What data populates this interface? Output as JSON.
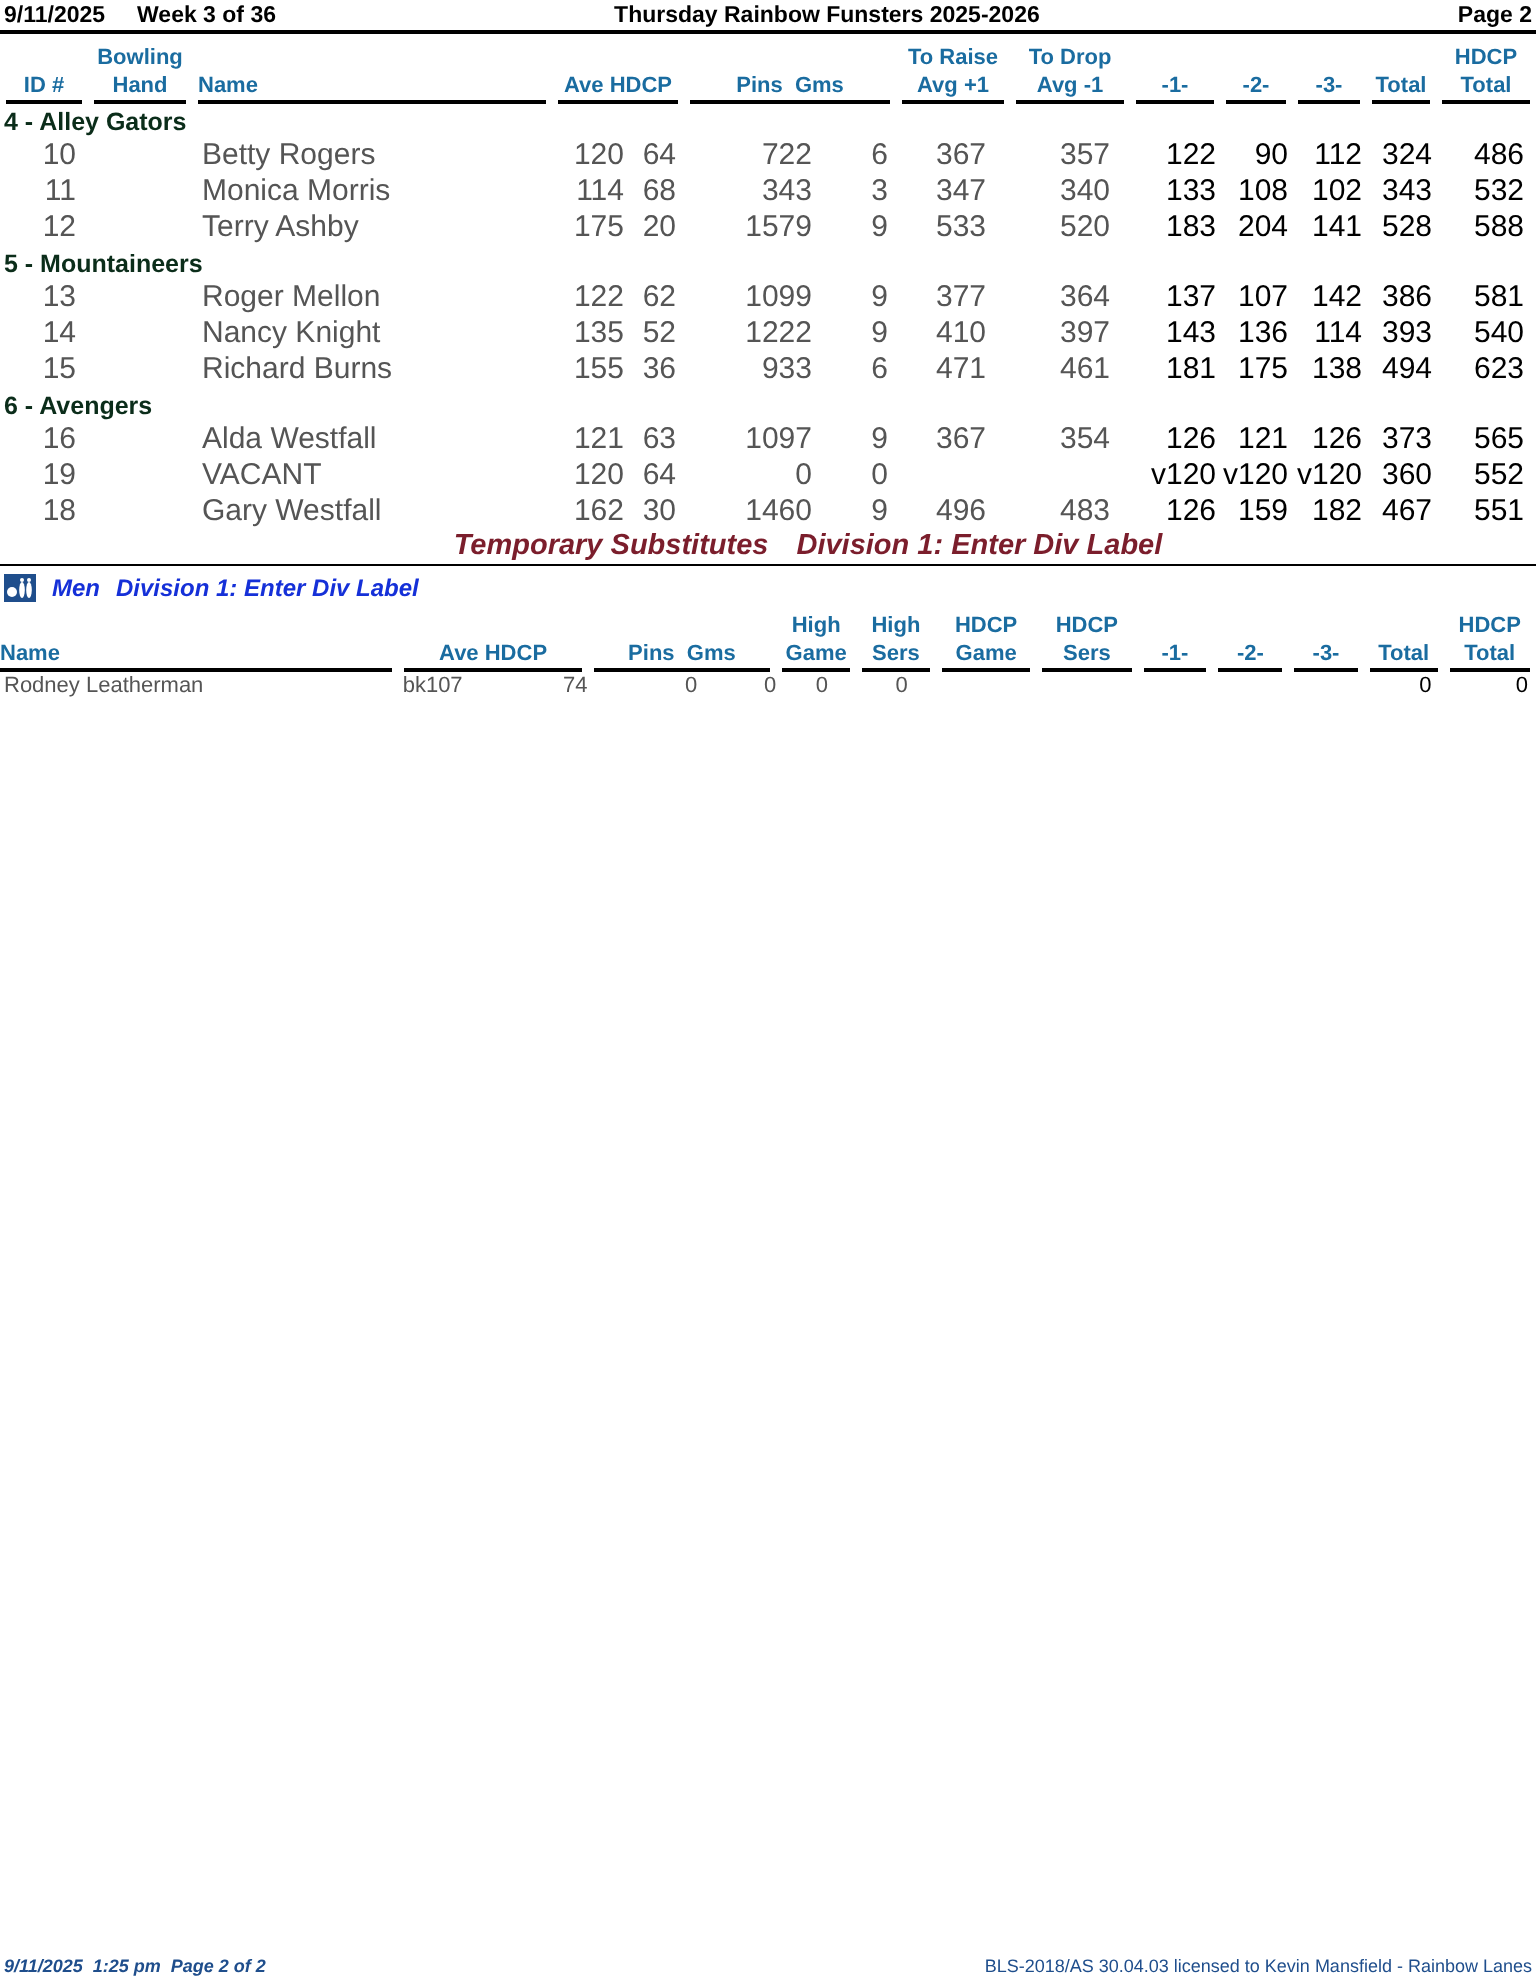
{
  "header": {
    "date": "9/11/2025",
    "week": "Week 3 of 36",
    "title": "Thursday Rainbow Funsters 2025-2026",
    "page": "Page 2"
  },
  "columns": [
    {
      "bottom": "ID #"
    },
    {
      "top": "Bowling",
      "bottom": "Hand"
    },
    {
      "bottom": "Name"
    },
    {
      "bottom": "Ave HDCP"
    },
    {
      "bottom": "Pins  Gms"
    },
    {
      "top": "To Raise",
      "bottom": "Avg +1"
    },
    {
      "top": "To Drop",
      "bottom": "Avg -1"
    },
    {
      "bottom": "-1-"
    },
    {
      "bottom": "-2-"
    },
    {
      "bottom": "-3-"
    },
    {
      "bottom": "Total"
    },
    {
      "top": "HDCP",
      "bottom": "Total"
    }
  ],
  "teams": [
    {
      "name": "4 - Alley Gators",
      "bowlers": [
        {
          "id": "10",
          "name": "Betty Rogers",
          "ave": "120",
          "hdcp": "64",
          "pins": "722",
          "gms": "6",
          "raise": "367",
          "drop": "357",
          "games": [
            "122",
            "90",
            "112"
          ],
          "total": "324",
          "hdcp_total": "486"
        },
        {
          "id": "11",
          "name": "Monica Morris",
          "ave": "114",
          "hdcp": "68",
          "pins": "343",
          "gms": "3",
          "raise": "347",
          "drop": "340",
          "games": [
            "133",
            "108",
            "102"
          ],
          "total": "343",
          "hdcp_total": "532"
        },
        {
          "id": "12",
          "name": "Terry Ashby",
          "ave": "175",
          "hdcp": "20",
          "pins": "1579",
          "gms": "9",
          "raise": "533",
          "drop": "520",
          "games": [
            "183",
            "204",
            "141"
          ],
          "total": "528",
          "hdcp_total": "588"
        }
      ]
    },
    {
      "name": "5 - Mountaineers",
      "bowlers": [
        {
          "id": "13",
          "name": "Roger Mellon",
          "ave": "122",
          "hdcp": "62",
          "pins": "1099",
          "gms": "9",
          "raise": "377",
          "drop": "364",
          "games": [
            "137",
            "107",
            "142"
          ],
          "total": "386",
          "hdcp_total": "581"
        },
        {
          "id": "14",
          "name": "Nancy Knight",
          "ave": "135",
          "hdcp": "52",
          "pins": "1222",
          "gms": "9",
          "raise": "410",
          "drop": "397",
          "games": [
            "143",
            "136",
            "114"
          ],
          "total": "393",
          "hdcp_total": "540"
        },
        {
          "id": "15",
          "name": "Richard Burns",
          "ave": "155",
          "hdcp": "36",
          "pins": "933",
          "gms": "6",
          "raise": "471",
          "drop": "461",
          "games": [
            "181",
            "175",
            "138"
          ],
          "total": "494",
          "hdcp_total": "623"
        }
      ]
    },
    {
      "name": "6 - Avengers",
      "bowlers": [
        {
          "id": "16",
          "name": "Alda Westfall",
          "ave": "121",
          "hdcp": "63",
          "pins": "1097",
          "gms": "9",
          "raise": "367",
          "drop": "354",
          "games": [
            "126",
            "121",
            "126"
          ],
          "total": "373",
          "hdcp_total": "565"
        },
        {
          "id": "19",
          "name": "VACANT",
          "ave": "120",
          "hdcp": "64",
          "pins": "0",
          "gms": "0",
          "games": [
            "v120",
            "v120",
            "v120"
          ],
          "total": "360",
          "hdcp_total": "552"
        },
        {
          "id": "18",
          "name": "Gary Westfall",
          "ave": "162",
          "hdcp": "30",
          "pins": "1460",
          "gms": "9",
          "raise": "496",
          "drop": "483",
          "games": [
            "126",
            "159",
            "182"
          ],
          "total": "467",
          "hdcp_total": "551"
        }
      ]
    }
  ],
  "subs_banner": {
    "title": "Temporary Substitutes",
    "division": "Division 1: Enter Div Label"
  },
  "subs": {
    "group": "Men",
    "division": "Division 1: Enter Div Label",
    "columns": [
      {
        "bottom": "Name"
      },
      {
        "bottom": "Ave HDCP"
      },
      {
        "bottom": "Pins  Gms"
      },
      {
        "top": "High",
        "bottom": "Game"
      },
      {
        "top": "High",
        "bottom": "Sers"
      },
      {
        "top": "HDCP",
        "bottom": "Game"
      },
      {
        "top": "HDCP",
        "bottom": "Sers"
      },
      {
        "bottom": "-1-"
      },
      {
        "bottom": "-2-"
      },
      {
        "bottom": "-3-"
      },
      {
        "bottom": "Total"
      },
      {
        "top": "HDCP",
        "bottom": "Total"
      }
    ],
    "rows": [
      {
        "name": "Rodney Leatherman",
        "ave": "bk107",
        "hdcp": "74",
        "pins": "0",
        "gms": "0",
        "high_game": "0",
        "high_sers": "0",
        "total": "0",
        "hdcp_total": "0"
      }
    ]
  },
  "footer": {
    "left": "9/11/2025  1:25 pm  Page 2 of 2",
    "right": "BLS-2018/AS 30.04.03 licensed to Kevin Mansfield - Rainbow Lanes"
  }
}
